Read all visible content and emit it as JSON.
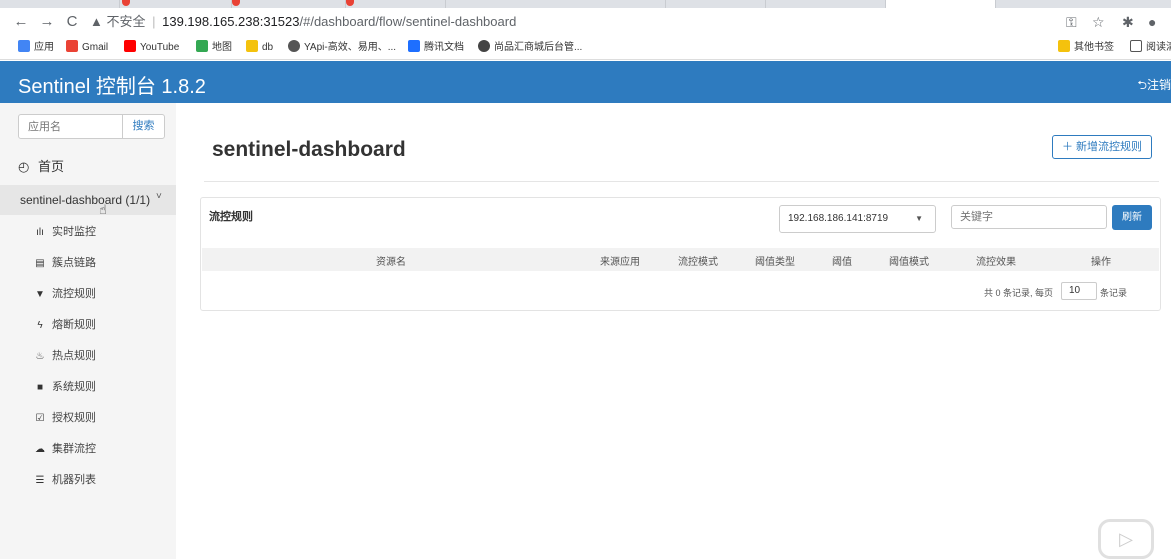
{
  "browser": {
    "address": {
      "warning": "▲ 不安全",
      "separator": "|",
      "host": "139.198.165.238:31523",
      "path": "/#/dashboard/flow/sentinel-dashboard"
    },
    "bookmarks": [
      {
        "label": "应用",
        "color": "#4285f4"
      },
      {
        "label": "Gmail",
        "color": "#ea4335"
      },
      {
        "label": "YouTube",
        "color": "#ff0000"
      },
      {
        "label": "地图",
        "color": "#34a853"
      },
      {
        "label": "db",
        "color": "#f4c20d"
      },
      {
        "label": "YApi-高效、易用、...",
        "color": "#555555"
      },
      {
        "label": "腾讯文档",
        "color": "#1e6fff"
      },
      {
        "label": "尚品汇商城后台管...",
        "color": "#444444"
      }
    ],
    "bookmarks_right": [
      {
        "label": "其他书签"
      },
      {
        "label": "阅读清"
      }
    ]
  },
  "header": {
    "title": "Sentinel 控制台 1.8.2",
    "logout": "⮌注销"
  },
  "sidebar": {
    "search_placeholder": "应用名",
    "search_button": "搜索",
    "home": "首页",
    "app": "sentinel-dashboard (1/1)",
    "items": [
      {
        "label": "实时监控",
        "icon": "bar-chart-icon"
      },
      {
        "label": "簇点链路",
        "icon": "list-icon"
      },
      {
        "label": "流控规则",
        "icon": "filter-icon"
      },
      {
        "label": "熔断规则",
        "icon": "bolt-icon"
      },
      {
        "label": "热点规则",
        "icon": "fire-icon"
      },
      {
        "label": "系统规则",
        "icon": "lock-icon"
      },
      {
        "label": "授权规则",
        "icon": "check-square-icon"
      },
      {
        "label": "集群流控",
        "icon": "cloud-icon"
      },
      {
        "label": "机器列表",
        "icon": "th-list-icon"
      }
    ]
  },
  "main": {
    "page_title": "sentinel-dashboard",
    "add_button": "＋ 新增流控规则",
    "panel_title": "流控规则",
    "machine": "192.168.186.141:8719",
    "keyword_placeholder": "关键字",
    "refresh": "刷新",
    "columns": [
      "资源名",
      "来源应用",
      "流控模式",
      "阈值类型",
      "阈值",
      "阈值模式",
      "流控效果",
      "操作"
    ],
    "pager": {
      "summary": "共 0 条记录, 每页",
      "page_size": "10",
      "suffix": "条记录"
    }
  },
  "colors": {
    "header_bg": "#2e7bbf",
    "accent": "#2e7bbf"
  }
}
